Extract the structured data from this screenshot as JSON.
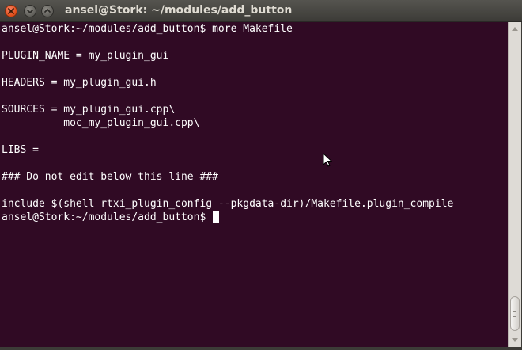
{
  "window": {
    "title": "ansel@Stork: ~/modules/add_button"
  },
  "controls": {
    "close_icon": "close-icon",
    "minimize_icon": "minimize-icon",
    "maximize_icon": "maximize-icon"
  },
  "terminal": {
    "background": "#300a24",
    "foreground": "#ffffff",
    "lines": [
      "ansel@Stork:~/modules/add_button$ more Makefile",
      "",
      "PLUGIN_NAME = my_plugin_gui",
      "",
      "HEADERS = my_plugin_gui.h",
      "",
      "SOURCES = my_plugin_gui.cpp\\",
      "          moc_my_plugin_gui.cpp\\",
      "",
      "LIBS =",
      "",
      "### Do not edit below this line ###",
      "",
      "include $(shell rtxi_plugin_config --pkgdata-dir)/Makefile.plugin_compile"
    ],
    "prompt": "ansel@Stork:~/modules/add_button$ "
  }
}
